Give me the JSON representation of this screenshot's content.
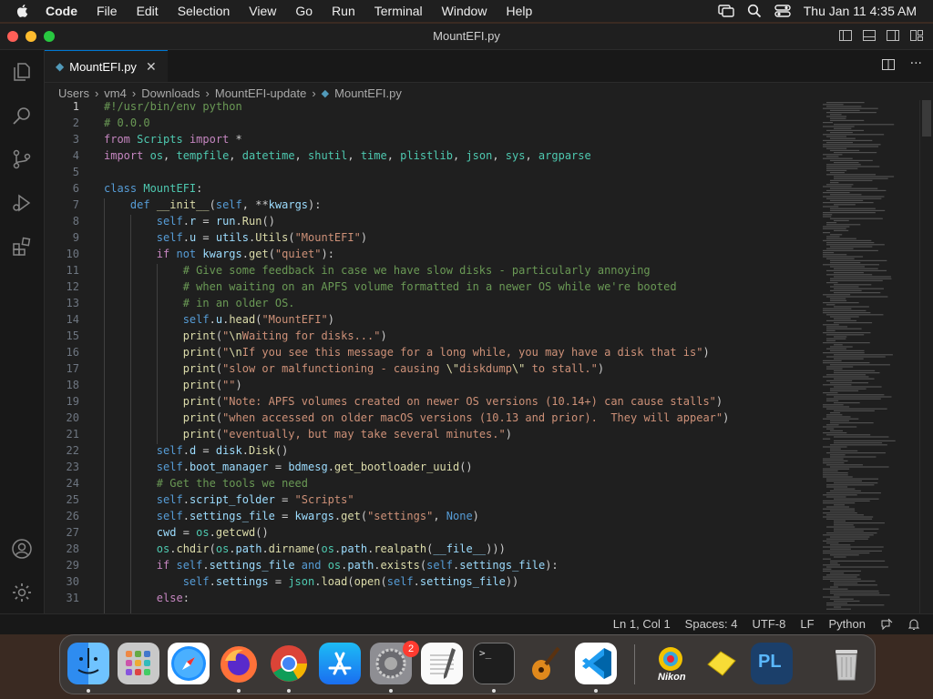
{
  "menubar": {
    "app": "Code",
    "items": [
      "File",
      "Edit",
      "Selection",
      "View",
      "Go",
      "Run",
      "Terminal",
      "Window",
      "Help"
    ],
    "datetime": "Thu Jan 11  4:35 AM"
  },
  "window": {
    "title": "MountEFI.py"
  },
  "tab": {
    "label": "MountEFI.py"
  },
  "breadcrumb": [
    "Users",
    "vm4",
    "Downloads",
    "MountEFI-update",
    "MountEFI.py"
  ],
  "editor": {
    "current_line": 1,
    "line_numbers": [
      "1",
      "2",
      "3",
      "4",
      "5",
      "6",
      "7",
      "8",
      "9",
      "10",
      "11",
      "12",
      "13",
      "14",
      "15",
      "16",
      "17",
      "18",
      "19",
      "20",
      "21",
      "22",
      "23",
      "24",
      "25",
      "26",
      "27",
      "28",
      "29",
      "30",
      "31"
    ]
  },
  "status": {
    "position": "Ln 1, Col 1",
    "spaces": "Spaces: 4",
    "encoding": "UTF-8",
    "eol": "LF",
    "language": "Python"
  },
  "dock": {
    "badge_system_settings": "2",
    "apps": [
      "finder",
      "launchpad",
      "safari",
      "firefox",
      "chrome",
      "app-store",
      "system-settings",
      "textedit",
      "terminal",
      "garageband",
      "vscode",
      "nikon",
      "sticky",
      "pl"
    ]
  },
  "colors": {
    "accent": "#0078d4",
    "editor_bg": "#1f1f1f",
    "keyword": "#c586c0",
    "string": "#ce9178",
    "comment": "#6a9955"
  }
}
